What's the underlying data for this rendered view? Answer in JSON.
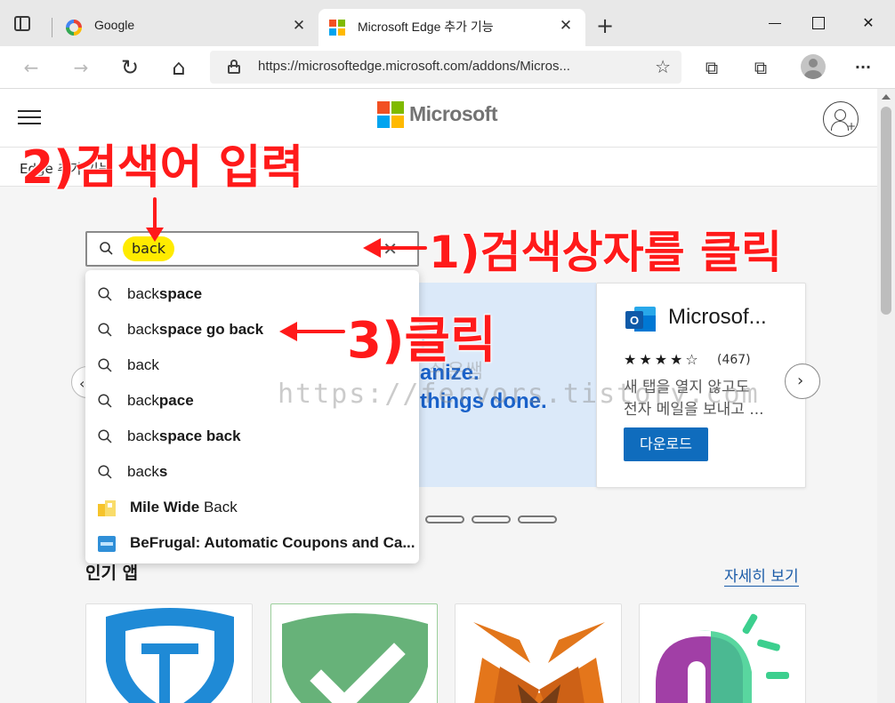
{
  "browser": {
    "tabs": [
      {
        "title": "Google",
        "close": "✕"
      },
      {
        "title": "Microsoft Edge 추가 기능",
        "close": "✕"
      }
    ],
    "new_tab": "+",
    "window": {
      "minimize": "",
      "maximize": "",
      "close": "✕"
    },
    "toolbar": {
      "back": "←",
      "forward": "→",
      "refresh": "↻",
      "home": "⌂",
      "url": "https://microsoftedge.microsoft.com/addons/Micros...",
      "favorite": "☆",
      "collections": "⧉",
      "extensions": "⧉",
      "menu": "···"
    }
  },
  "ms_header": {
    "brand": "Microsoft"
  },
  "subnav": {
    "label": "Edge 추가 기능"
  },
  "search": {
    "query": "back",
    "clear": "✕"
  },
  "suggestions": [
    {
      "typed": "back",
      "rest": "space"
    },
    {
      "typed": "back",
      "rest": "space go back"
    },
    {
      "typed": "back",
      "rest": ""
    },
    {
      "typed": "back",
      "rest": "pace"
    },
    {
      "typed": "back",
      "rest": "space back"
    },
    {
      "typed": "back",
      "rest": "s"
    }
  ],
  "app_suggestions": [
    {
      "name": "Mile Wide",
      "rest": " Back"
    },
    {
      "name": "BeFrugal: Automatic Coupons and Ca...",
      "rest": ""
    }
  ],
  "carousel": {
    "promo_lines": [
      "t.",
      "anize.",
      "things done."
    ],
    "left": "‹",
    "right": "›",
    "card": {
      "title": "Microsof...",
      "stars": "★★★★☆",
      "rating_count": "(467)",
      "desc1": "새 탭을 열지 않고도",
      "desc2": "전자 메일을 보내고 ...",
      "button": "다운로드"
    }
  },
  "popular": {
    "title": "인기 앱",
    "more": "자세히 보기"
  },
  "watermark": {
    "url": "https://fervors.tistory.com",
    "sig": "쉬운쌤"
  },
  "annotations": {
    "step2": "2)검색어 입력",
    "step1": "1)검색상자를 클릭",
    "step3": "3)클릭"
  },
  "colors": {
    "annotation": "#ff1a1a",
    "highlight": "#ffeb00",
    "accent": "#0f6cbd"
  }
}
